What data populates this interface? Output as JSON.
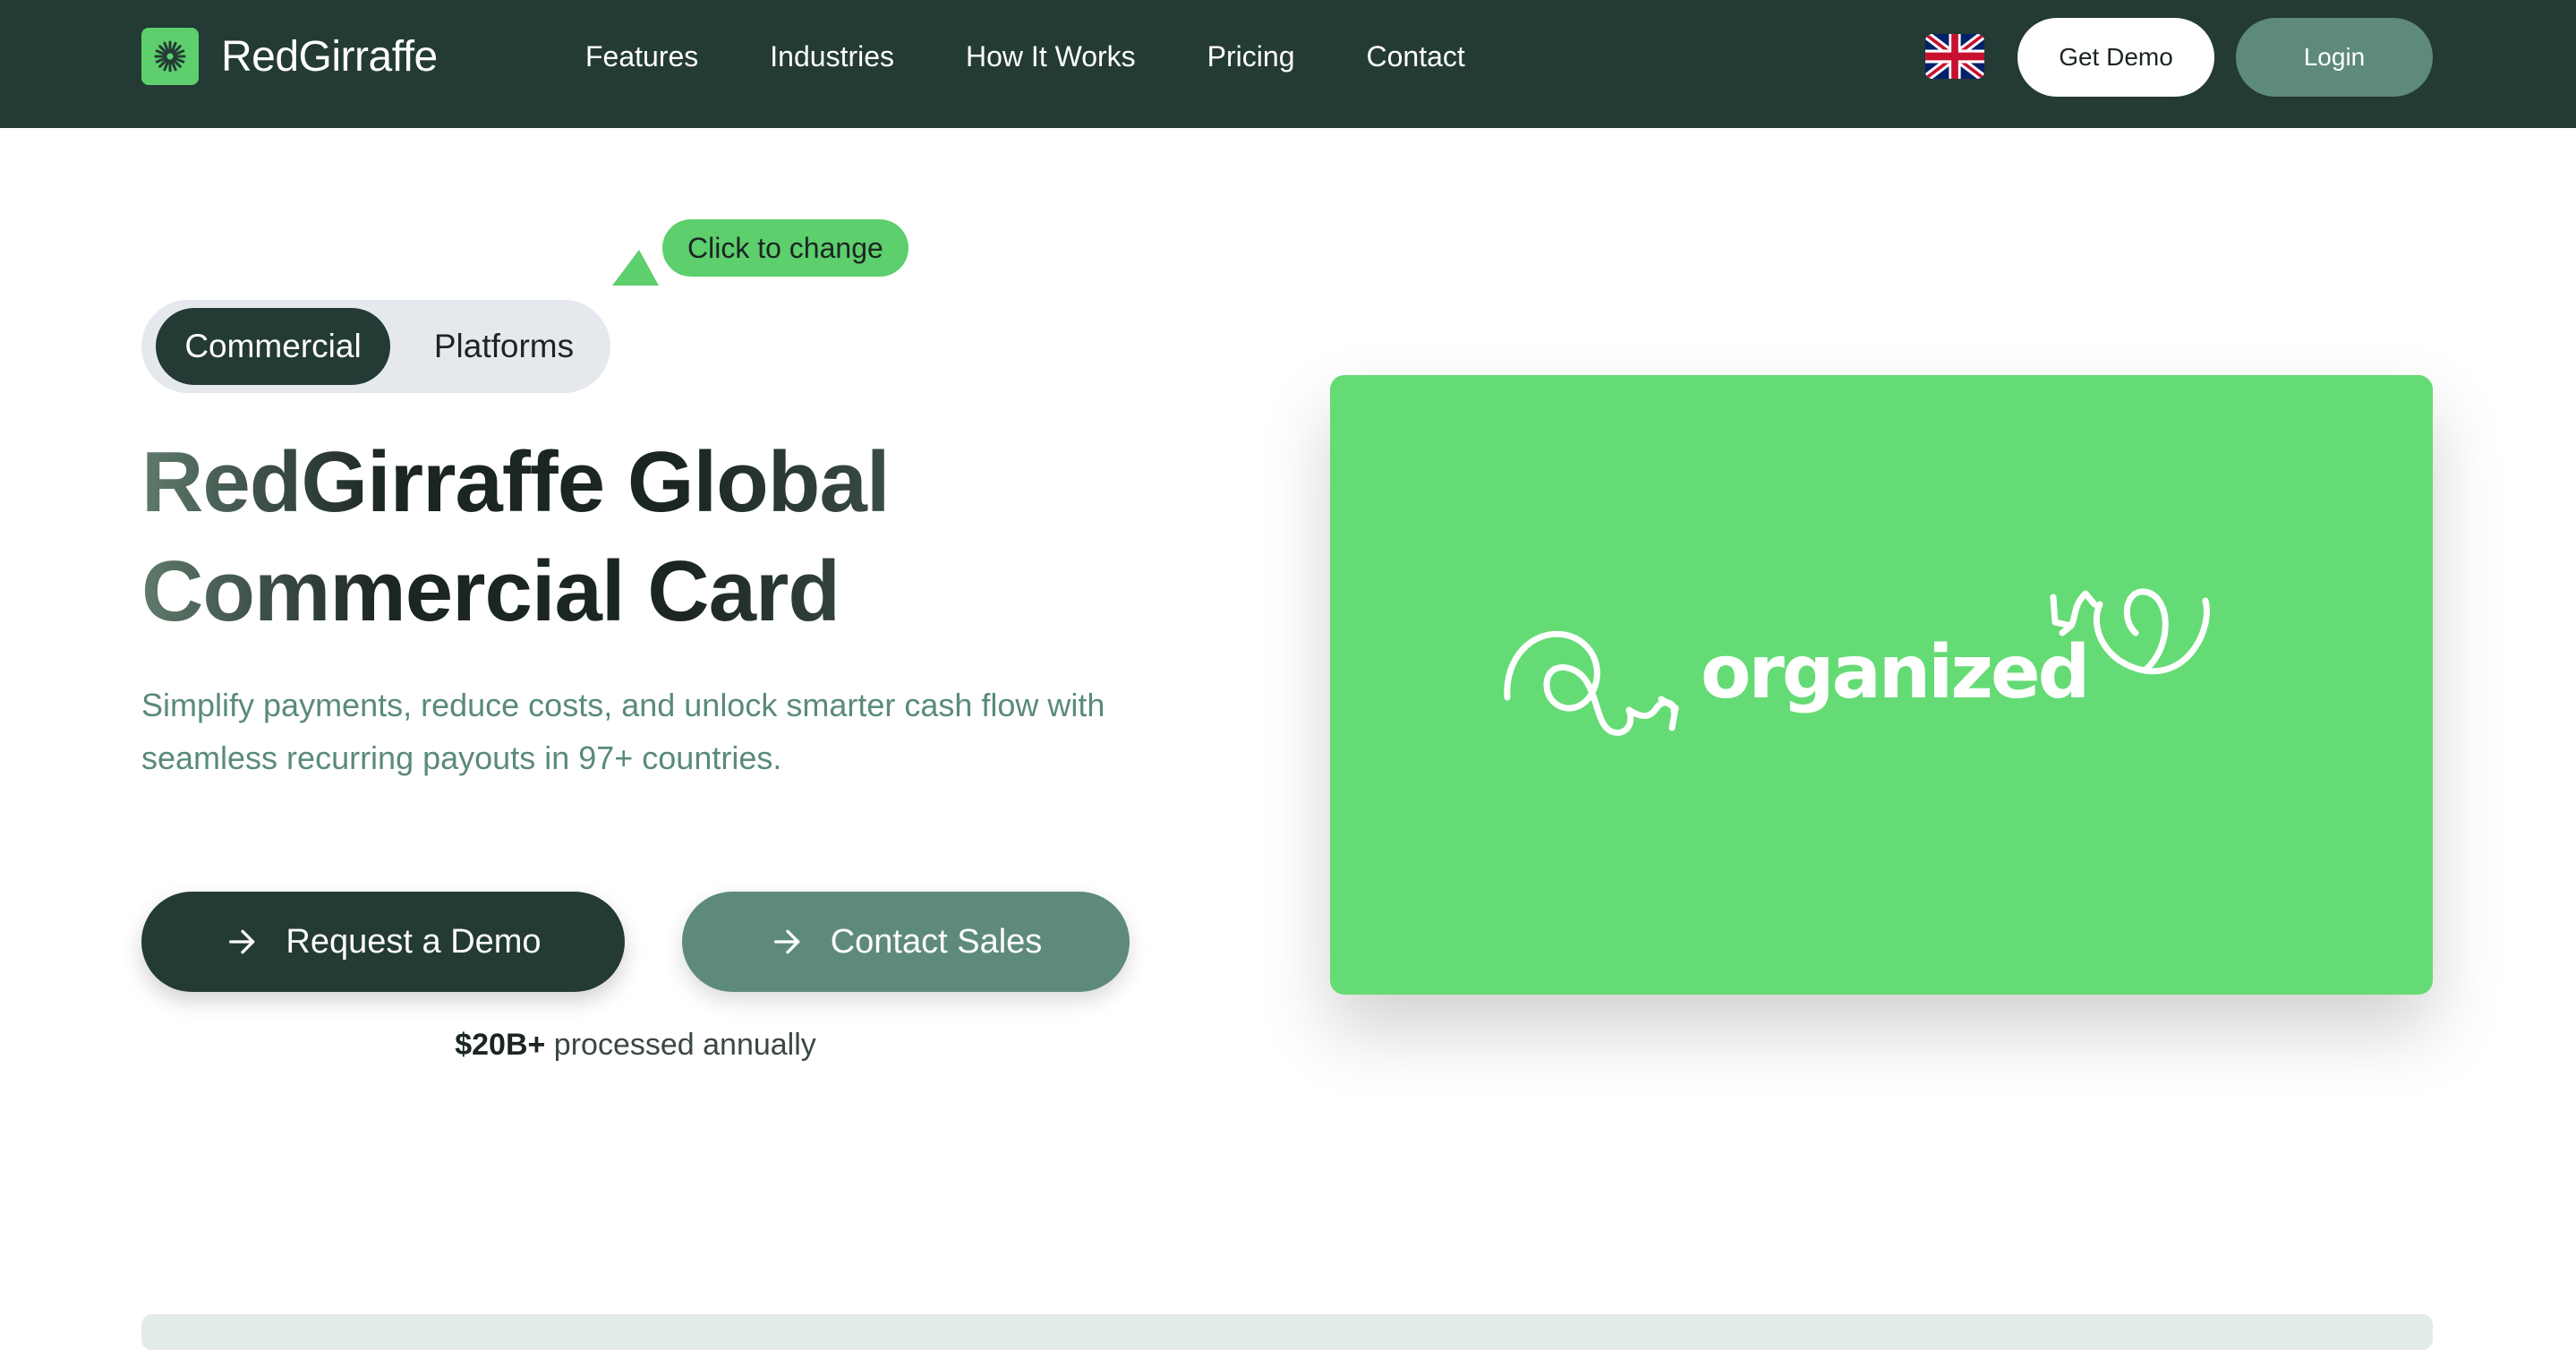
{
  "brand": {
    "name": "RedGirraffe"
  },
  "nav": {
    "links": [
      "Features",
      "Industries",
      "How It Works",
      "Pricing",
      "Contact"
    ],
    "language": "uk-flag-icon",
    "get_demo": "Get Demo",
    "login": "Login"
  },
  "hero": {
    "tooltip": "Click to change",
    "toggle": {
      "active": "Commercial",
      "inactive": "Platforms"
    },
    "headline_line1": "RedGirraffe Global",
    "headline_line2": "Commercial Card",
    "subtitle": "Simplify payments, reduce costs, and unlock smarter cash flow with seamless recurring payouts in 97+ countries.",
    "primary_cta": "Request a Demo",
    "secondary_cta": "Contact Sales",
    "stat_value": "$20B+",
    "stat_label": " processed annually",
    "card_word": "organized"
  },
  "colors": {
    "nav_bg": "#243a35",
    "accent_green": "#5dcf6c",
    "card_green": "#65db75",
    "muted_teal": "#5e8a7d"
  }
}
